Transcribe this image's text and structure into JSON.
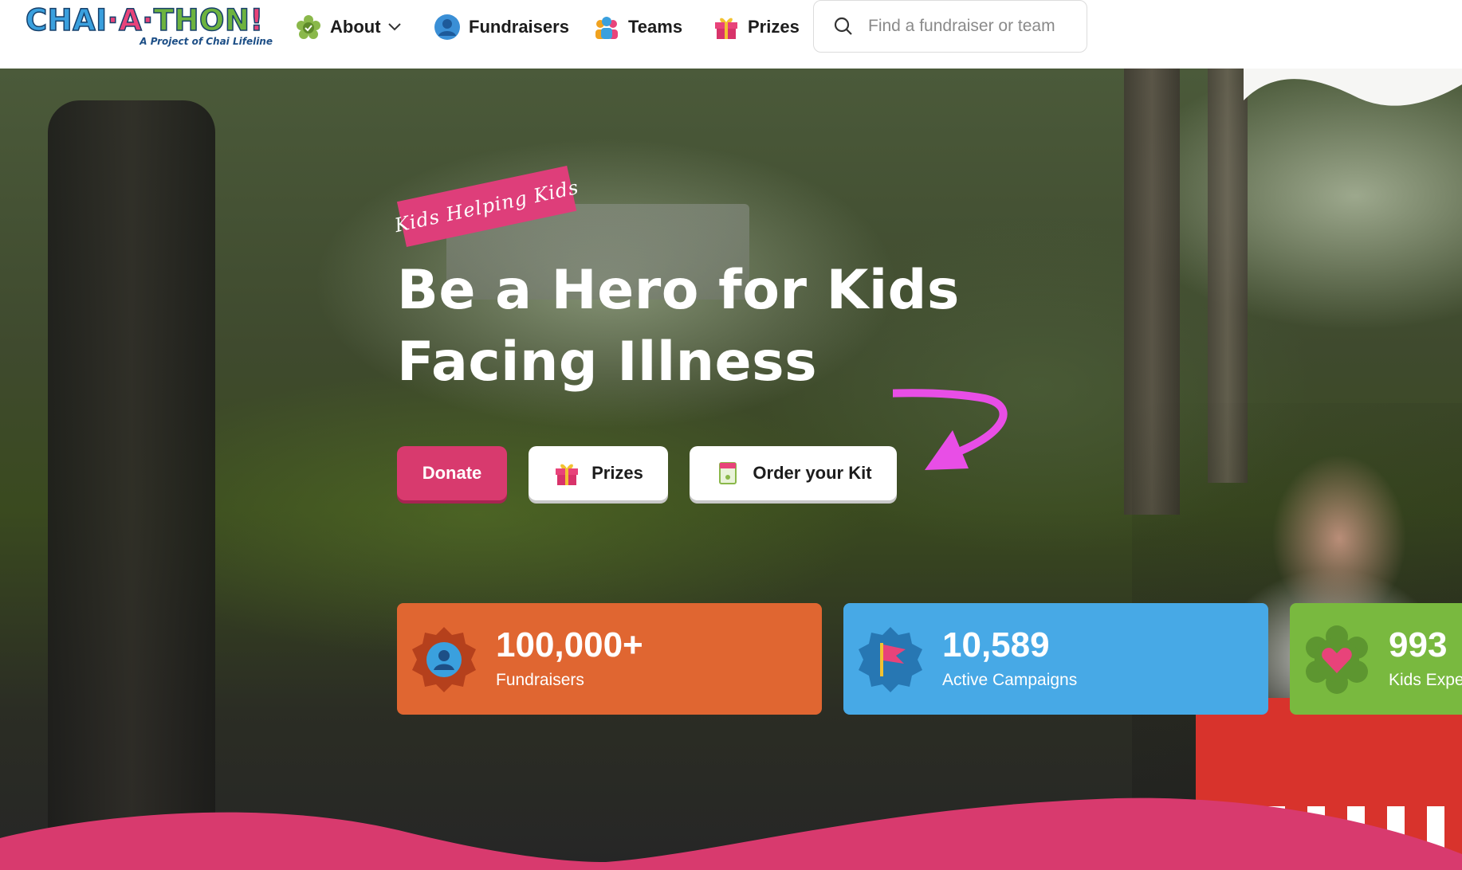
{
  "header": {
    "logo_text": [
      "CHAI",
      "·A·",
      "THON",
      "!"
    ],
    "logo_subtitle": "A Project of Chai Lifeline",
    "nav": {
      "about": "About",
      "fundraisers": "Fundraisers",
      "teams": "Teams",
      "prizes": "Prizes"
    },
    "search_placeholder": "Find a fundraiser or team"
  },
  "hero": {
    "tag": "Kids Helping Kids",
    "headline_line1": "Be a Hero for Kids",
    "headline_line2": "Facing Illness",
    "buttons": {
      "donate": "Donate",
      "prizes": "Prizes",
      "order_kit": "Order your Kit"
    }
  },
  "stats": [
    {
      "value": "100,000+",
      "label": "Fundraisers",
      "color": "#e06631",
      "icon": "user-badge-icon"
    },
    {
      "value": "10,589",
      "label": "Active Campaigns",
      "color": "#47a9e6",
      "icon": "flag-badge-icon"
    },
    {
      "value": "993",
      "label": "Kids Expe",
      "color": "#79b93f",
      "icon": "heart-badge-icon"
    }
  ],
  "colors": {
    "brand_pink": "#d83a6e",
    "arrow_magenta": "#e84ee6",
    "wave_pink": "#d83a6e"
  }
}
